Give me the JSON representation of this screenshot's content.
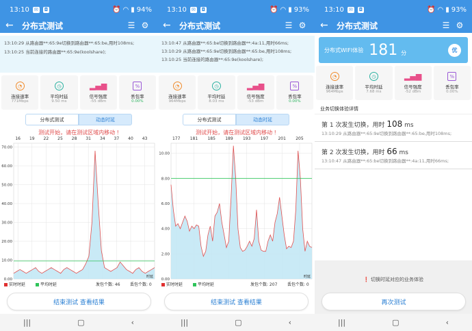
{
  "screens": [
    {
      "time": "13:10",
      "battery": "94%",
      "title": "分布式测试",
      "log": [
        "13:10:29 从路由器**:65:9e切换到路由器**:65:be,用时108ms;",
        "13:10:25 当前连接的路由器**:65:9e(koolshare);"
      ],
      "stats": [
        {
          "label": "连接速率",
          "value": "771Mbps",
          "color": "#f08a2a",
          "icon": "gauge-icon"
        },
        {
          "label": "平均时延",
          "value": "9.50 ms",
          "color": "#2ab1a0",
          "icon": "clock-icon"
        },
        {
          "label": "信号强度",
          "value": "-55 dBm",
          "color": "#e8508a",
          "icon": "signal-bars-icon"
        },
        {
          "label": "丢包率",
          "value": "0.00%",
          "color": "#9a58d6",
          "icon": "percent-icon"
        }
      ],
      "tab1": "分布式测试",
      "tab2": "动态时延",
      "hint": "测试开始，请在测试区域内移动",
      "legend": {
        "realtime": "实时时延",
        "average": "平均时延",
        "sent": "发包个数: 46",
        "lost": "丢包个数: 0"
      },
      "button": "结束测试  查看结果"
    },
    {
      "time": "13:10",
      "battery": "93%",
      "title": "分布式测试",
      "log": [
        "13:10:47 从路由器**:65:be切换到路由器**:4a:11,用时66ms;",
        "13:10:29 从路由器**:65:9e切换到路由器**:65:be,用时108ms;",
        "13:10:25 当前连接的路由器**:65:9e(koolshare);"
      ],
      "stats": [
        {
          "label": "连接速率",
          "value": "964Mbps",
          "color": "#f08a2a",
          "icon": "gauge-icon"
        },
        {
          "label": "平均时延",
          "value": "8.03 ms",
          "color": "#2ab1a0",
          "icon": "clock-icon"
        },
        {
          "label": "信号强度",
          "value": "-53 dBm",
          "color": "#e8508a",
          "icon": "signal-bars-icon"
        },
        {
          "label": "丢包率",
          "value": "0.00%",
          "color": "#9a58d6",
          "icon": "percent-icon"
        }
      ],
      "tab1": "分布式测试",
      "tab2": "动态时延",
      "hint": "测试开始，请在测试区域内移动",
      "legend": {
        "realtime": "实时时延",
        "average": "平均时延",
        "sent": "发包个数: 207",
        "lost": "丢包个数: 0"
      },
      "button": "结束测试  查看结果"
    },
    {
      "time": "13:10",
      "battery": "93%",
      "title": "分布式测试",
      "score_label": "分布式WIFI体验",
      "score": "181",
      "score_unit": "分",
      "badge": "优",
      "stats": [
        {
          "label": "连接速率",
          "value": "964Mbps",
          "color": "#f08a2a",
          "icon": "gauge-icon"
        },
        {
          "label": "平均时延",
          "value": "7.68 ms",
          "color": "#2ab1a0",
          "icon": "clock-icon"
        },
        {
          "label": "信号强度",
          "value": "-52 dBm",
          "color": "#e8508a",
          "icon": "signal-bars-icon"
        },
        {
          "label": "丢包率",
          "value": "0.00%",
          "color": "#9a58d6",
          "icon": "percent-icon"
        }
      ],
      "section": "业务切换体验详情",
      "items": [
        {
          "prefix": "第 1 次发生切换，用时 ",
          "ms": "108",
          "unit": " ms",
          "detail": "13:10:29 从路由器**:65:9e切换到路由器**:65:be,用时108ms;"
        },
        {
          "prefix": "第 2 次发生切换，用时 ",
          "ms": "66",
          "unit": " ms",
          "detail": "13:10:47 从路由器**:65:be切换到路由器**:4a:11,用时66ms;"
        }
      ],
      "note": "切换时延对应的业务体验",
      "button": "再次测试"
    }
  ],
  "chart_data": [
    {
      "type": "area",
      "x_ticks": [
        "16",
        "19",
        "22",
        "25",
        "28",
        "31",
        "34",
        "37",
        "40",
        "43"
      ],
      "y_ticks": [
        "70.00",
        "60.00",
        "50.00",
        "40.00",
        "30.00",
        "20.00",
        "10.00",
        "0.00"
      ],
      "ylim": [
        0,
        72
      ],
      "average": 9.5,
      "axis_label": "时延",
      "values": [
        3,
        4,
        5,
        4,
        3,
        4,
        5,
        6,
        4,
        3,
        4,
        5,
        6,
        5,
        4,
        3,
        5,
        6,
        5,
        4,
        3,
        4,
        5,
        8,
        12,
        30,
        68,
        40,
        15,
        6,
        5,
        4,
        5,
        6,
        9,
        7,
        5,
        4,
        3,
        5,
        6,
        4,
        3,
        4,
        5,
        6
      ]
    },
    {
      "type": "area",
      "x_ticks": [
        "177",
        "181",
        "185",
        "189",
        "193",
        "197",
        "201",
        "205"
      ],
      "y_ticks": [
        "10.00",
        "8.00",
        "6.00",
        "4.00",
        "2.00",
        "0.00"
      ],
      "ylim": [
        0,
        10.8
      ],
      "average": 8.0,
      "axis_label": "时延",
      "values": [
        7.5,
        5.5,
        4.2,
        4.4,
        4.0,
        4.5,
        5.0,
        4.6,
        3.8,
        4.2,
        4.0,
        4.3,
        4.2,
        2.6,
        1.8,
        2.2,
        3.5,
        4.2,
        3.0,
        5.0,
        5.3,
        6.0,
        4.5,
        3.5,
        2.5,
        3.0,
        6.5,
        10.6,
        8.0,
        4.0,
        2.5,
        2.2,
        2.3,
        2.6,
        3.0,
        2.6,
        3.2,
        5.5,
        3.0,
        2.3,
        2.2,
        2.2,
        3.0,
        3.5,
        3.0,
        4.5,
        5.2,
        6.5,
        5.0,
        3.5,
        2.4,
        2.6,
        2.5,
        3.0,
        5.5,
        10.2,
        8.0,
        4.0,
        2.2,
        3.0,
        2.6,
        2.5
      ]
    }
  ]
}
